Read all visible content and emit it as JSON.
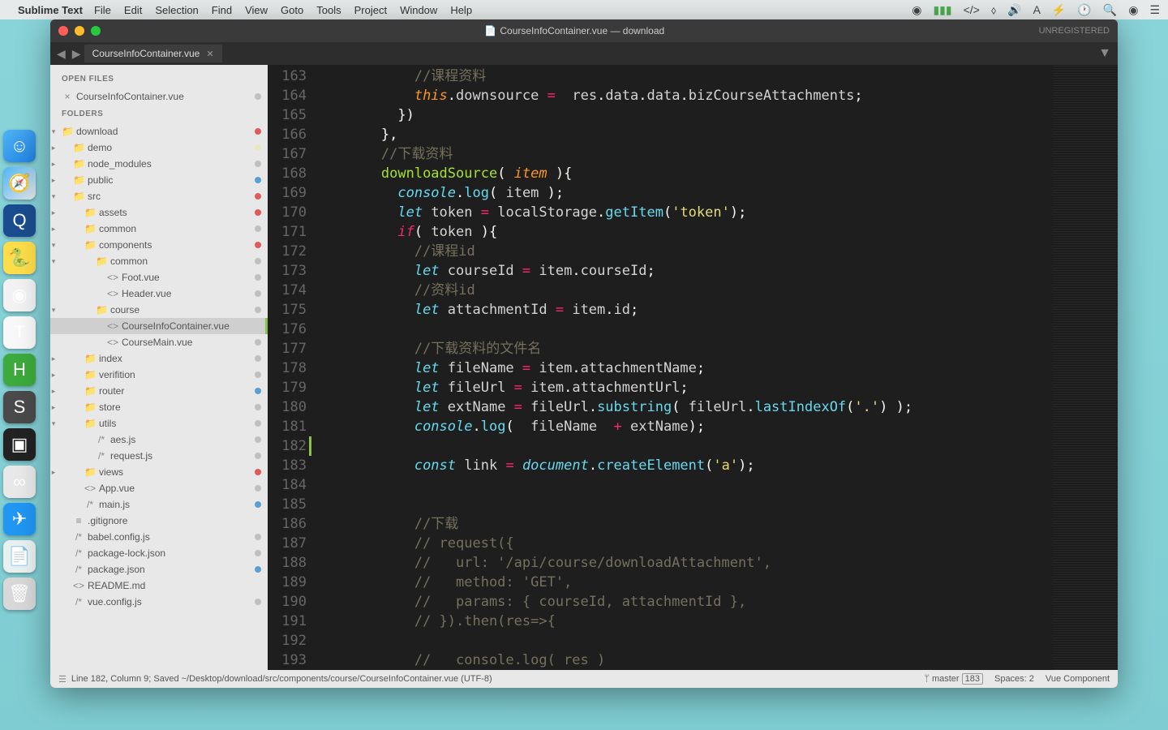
{
  "menubar": {
    "appname": "Sublime Text",
    "items": [
      "File",
      "Edit",
      "Selection",
      "Find",
      "View",
      "Goto",
      "Tools",
      "Project",
      "Window",
      "Help"
    ]
  },
  "window": {
    "title": "CourseInfoContainer.vue — download",
    "unregistered": "UNREGISTERED"
  },
  "tab": {
    "name": "CourseInfoContainer.vue"
  },
  "sidebar": {
    "open_files": "OPEN FILES",
    "open_file_name": "CourseInfoContainer.vue",
    "folders": "FOLDERS",
    "tree": [
      {
        "label": "download",
        "indent": 0,
        "icon": "▸",
        "folder": true,
        "open": true,
        "dot": "#e05a5a"
      },
      {
        "label": "demo",
        "indent": 1,
        "icon": "▸",
        "folder": true,
        "dot": "#e8e8c0"
      },
      {
        "label": "node_modules",
        "indent": 1,
        "icon": "▸",
        "folder": true,
        "dot": "#c0c0c0"
      },
      {
        "label": "public",
        "indent": 1,
        "icon": "▸",
        "folder": true,
        "dot": "#5a9fd4"
      },
      {
        "label": "src",
        "indent": 1,
        "icon": "▾",
        "folder": true,
        "open": true,
        "dot": "#e05a5a"
      },
      {
        "label": "assets",
        "indent": 2,
        "icon": "▸",
        "folder": true,
        "dot": "#e05a5a"
      },
      {
        "label": "common",
        "indent": 2,
        "icon": "▸",
        "folder": true,
        "dot": "#c0c0c0"
      },
      {
        "label": "components",
        "indent": 2,
        "icon": "▾",
        "folder": true,
        "open": true,
        "dot": "#e05a5a"
      },
      {
        "label": "common",
        "indent": 3,
        "icon": "▾",
        "folder": true,
        "open": true,
        "dot": "#c0c0c0"
      },
      {
        "label": "Foot.vue",
        "indent": 4,
        "icon": "<>",
        "dot": "#c0c0c0"
      },
      {
        "label": "Header.vue",
        "indent": 4,
        "icon": "<>",
        "dot": "#c0c0c0"
      },
      {
        "label": "course",
        "indent": 3,
        "icon": "▾",
        "folder": true,
        "open": true,
        "dot": "#c0c0c0"
      },
      {
        "label": "CourseInfoContainer.vue",
        "indent": 4,
        "icon": "<>",
        "active": true,
        "bar": true
      },
      {
        "label": "CourseMain.vue",
        "indent": 4,
        "icon": "<>",
        "dot": "#c0c0c0"
      },
      {
        "label": "index",
        "indent": 2,
        "icon": "▸",
        "folder": true,
        "dot": "#c0c0c0"
      },
      {
        "label": "verifition",
        "indent": 2,
        "icon": "▸",
        "folder": true,
        "dot": "#c0c0c0"
      },
      {
        "label": "router",
        "indent": 2,
        "icon": "▸",
        "folder": true,
        "dot": "#5a9fd4"
      },
      {
        "label": "store",
        "indent": 2,
        "icon": "▸",
        "folder": true,
        "dot": "#c0c0c0"
      },
      {
        "label": "utils",
        "indent": 2,
        "icon": "▾",
        "folder": true,
        "open": true,
        "dot": "#c0c0c0"
      },
      {
        "label": "aes.js",
        "indent": 3,
        "icon": "/*",
        "dot": "#c0c0c0"
      },
      {
        "label": "request.js",
        "indent": 3,
        "icon": "/*",
        "dot": "#c0c0c0"
      },
      {
        "label": "views",
        "indent": 2,
        "icon": "▸",
        "folder": true,
        "dot": "#e05a5a"
      },
      {
        "label": "App.vue",
        "indent": 2,
        "icon": "<>",
        "dot": "#c0c0c0"
      },
      {
        "label": "main.js",
        "indent": 2,
        "icon": "/*",
        "dot": "#5a9fd4"
      },
      {
        "label": ".gitignore",
        "indent": 1,
        "icon": "≡",
        "dot": ""
      },
      {
        "label": "babel.config.js",
        "indent": 1,
        "icon": "/*",
        "dot": "#c0c0c0"
      },
      {
        "label": "package-lock.json",
        "indent": 1,
        "icon": "/*",
        "dot": "#c0c0c0"
      },
      {
        "label": "package.json",
        "indent": 1,
        "icon": "/*",
        "dot": "#5a9fd4"
      },
      {
        "label": "README.md",
        "indent": 1,
        "icon": "<>",
        "dot": ""
      },
      {
        "label": "vue.config.js",
        "indent": 1,
        "icon": "/*",
        "dot": "#c0c0c0"
      }
    ]
  },
  "code": {
    "lines": [
      {
        "n": 163,
        "html": "            <span class='com'>//课程资料</span>"
      },
      {
        "n": 164,
        "html": "            <span class='this'>this</span><span class='punc'>.</span>downsource <span class='op'>=</span>  res<span class='punc'>.</span>data<span class='punc'>.</span>data<span class='punc'>.</span>bizCourseAttachments<span class='punc'>;</span>"
      },
      {
        "n": 165,
        "html": "          <span class='punc'>})</span>"
      },
      {
        "n": 166,
        "html": "        <span class='punc'>},</span>"
      },
      {
        "n": 167,
        "html": "        <span class='com'>//下载资料</span>"
      },
      {
        "n": 168,
        "html": "        <span class='fname'>downloadSource</span><span class='punc'>(</span> <span class='param'>item</span> <span class='punc'>){</span>"
      },
      {
        "n": 169,
        "html": "          <span class='obj'>console</span><span class='punc'>.</span><span class='fn'>log</span><span class='punc'>(</span> item <span class='punc'>);</span>"
      },
      {
        "n": 170,
        "html": "          <span class='storage'>let</span> token <span class='op'>=</span> localStorage<span class='punc'>.</span><span class='fn'>getItem</span><span class='punc'>(</span><span class='str'>'token'</span><span class='punc'>);</span>"
      },
      {
        "n": 171,
        "html": "          <span class='kw'>if</span><span class='punc'>(</span> token <span class='punc'>){</span>"
      },
      {
        "n": 172,
        "html": "            <span class='com'>//课程id</span>"
      },
      {
        "n": 173,
        "html": "            <span class='storage'>let</span> courseId <span class='op'>=</span> item<span class='punc'>.</span>courseId<span class='punc'>;</span>"
      },
      {
        "n": 174,
        "html": "            <span class='com'>//资料id</span>"
      },
      {
        "n": 175,
        "html": "            <span class='storage'>let</span> attachmentId <span class='op'>=</span> item<span class='punc'>.</span>id<span class='punc'>;</span>"
      },
      {
        "n": 176,
        "html": ""
      },
      {
        "n": 177,
        "html": "            <span class='com'>//下载资料的文件名</span>"
      },
      {
        "n": 178,
        "html": "            <span class='storage'>let</span> fileName <span class='op'>=</span> item<span class='punc'>.</span>attachmentName<span class='punc'>;</span>"
      },
      {
        "n": 179,
        "html": "            <span class='storage'>let</span> fileUrl <span class='op'>=</span> item<span class='punc'>.</span>attachmentUrl<span class='punc'>;</span>"
      },
      {
        "n": 180,
        "html": "            <span class='storage'>let</span> extName <span class='op'>=</span> fileUrl<span class='punc'>.</span><span class='fn'>substring</span><span class='punc'>(</span> fileUrl<span class='punc'>.</span><span class='fn'>lastIndexOf</span><span class='punc'>(</span><span class='str'>'.'</span><span class='punc'>) );</span>"
      },
      {
        "n": 181,
        "html": "            <span class='obj'>console</span><span class='punc'>.</span><span class='fn'>log</span><span class='punc'>(</span>  fileName  <span class='op'>+</span> extName<span class='punc'>);</span>"
      },
      {
        "n": 182,
        "html": "",
        "mark": true
      },
      {
        "n": 183,
        "html": "            <span class='storage'>const</span> link <span class='op'>=</span> <span class='obj'>document</span><span class='punc'>.</span><span class='fn'>createElement</span><span class='punc'>(</span><span class='str'>'a'</span><span class='punc'>);</span>"
      },
      {
        "n": 184,
        "html": ""
      },
      {
        "n": 185,
        "html": ""
      },
      {
        "n": 186,
        "html": "            <span class='com'>//下载</span>"
      },
      {
        "n": 187,
        "html": "            <span class='com'>// request({</span>"
      },
      {
        "n": 188,
        "html": "            <span class='com'>//   url: '/api/course/downloadAttachment',</span>"
      },
      {
        "n": 189,
        "html": "            <span class='com'>//   method: 'GET',</span>"
      },
      {
        "n": 190,
        "html": "            <span class='com'>//   params: { courseId, attachmentId },</span>"
      },
      {
        "n": 191,
        "html": "            <span class='com'>// }).then(res=>{</span>"
      },
      {
        "n": 192,
        "html": ""
      },
      {
        "n": 193,
        "html": "            <span class='com'>//   console.log( res )</span>"
      }
    ]
  },
  "statusbar": {
    "left": "Line 182, Column 9; Saved ~/Desktop/download/src/components/course/CourseInfoContainer.vue (UTF-8)",
    "branch": "master",
    "count": "183",
    "spaces": "Spaces: 2",
    "syntax": "Vue Component"
  }
}
